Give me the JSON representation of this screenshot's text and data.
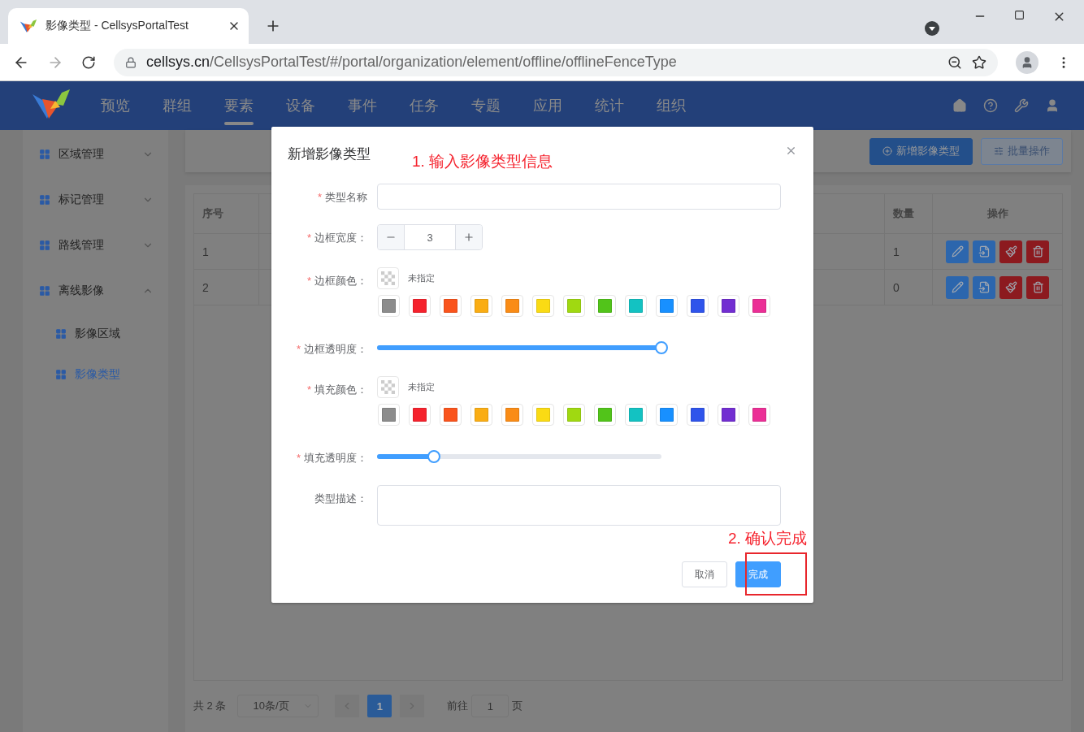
{
  "browser": {
    "tab_title": "影像类型 - CellsysPortalTest",
    "url": {
      "host": "cellsys.cn",
      "path": "/CellsysPortalTest/#/portal/organization/element/offline/offlineFenceType"
    }
  },
  "nav": {
    "items": [
      {
        "label": "预览",
        "selected": false
      },
      {
        "label": "群组",
        "selected": false
      },
      {
        "label": "要素",
        "selected": true
      },
      {
        "label": "设备",
        "selected": false
      },
      {
        "label": "事件",
        "selected": false
      },
      {
        "label": "任务",
        "selected": false
      },
      {
        "label": "专题",
        "selected": false
      },
      {
        "label": "应用",
        "selected": false
      },
      {
        "label": "统计",
        "selected": false
      },
      {
        "label": "组织",
        "selected": false
      }
    ]
  },
  "sidebar": {
    "items": [
      {
        "label": "区域管理",
        "expanded": false,
        "selected": false
      },
      {
        "label": "标记管理",
        "expanded": false,
        "selected": false
      },
      {
        "label": "路线管理",
        "expanded": false,
        "selected": false
      },
      {
        "label": "离线影像",
        "expanded": true,
        "selected": false,
        "children": [
          {
            "label": "影像区域",
            "selected": false
          },
          {
            "label": "影像类型",
            "selected": true
          }
        ]
      }
    ]
  },
  "toolbar": {
    "buttons": [
      {
        "label": "新增影像类型",
        "kind": "primary"
      },
      {
        "label": "批量操作",
        "kind": "plain"
      }
    ]
  },
  "table": {
    "columns": [
      "序号",
      "数量",
      "操作"
    ],
    "rows": [
      {
        "index": "1",
        "count": "1"
      },
      {
        "index": "2",
        "count": "0"
      }
    ]
  },
  "pagination": {
    "total": "共 2 条",
    "page_size": "10条/页",
    "pages": [
      {
        "label": "1",
        "selected": true
      }
    ],
    "goto_label": "前往",
    "goto_value": "1",
    "goto_suffix": "页"
  },
  "dialog": {
    "title": "新增影像类型",
    "fields": [
      {
        "kind": "text",
        "label": "类型名称",
        "marker": "*"
      },
      {
        "kind": "number",
        "label": "边框宽度：",
        "marker": "*",
        "value": "3"
      },
      {
        "kind": "color",
        "label": "边框颜色：",
        "marker": "*",
        "current": "未指定",
        "swatches": [
          {
            "color": "#8c8c8c"
          },
          {
            "color": "#f5222d"
          },
          {
            "color": "#fa541c"
          },
          {
            "color": "#faad14"
          },
          {
            "color": "#fa8c16"
          },
          {
            "color": "#fadb14"
          },
          {
            "color": "#a0d911"
          },
          {
            "color": "#52c41a"
          },
          {
            "color": "#13c2c2"
          },
          {
            "color": "#1890ff"
          },
          {
            "color": "#2f54eb"
          },
          {
            "color": "#722ed1"
          },
          {
            "color": "#eb2f96"
          }
        ]
      },
      {
        "kind": "slider",
        "label": "边框透明度：",
        "marker": "*",
        "level": 1
      },
      {
        "kind": "color",
        "label": "填充颜色：",
        "marker": "*",
        "current": "未指定",
        "swatches": [
          {
            "color": "#8c8c8c"
          },
          {
            "color": "#f5222d"
          },
          {
            "color": "#fa541c"
          },
          {
            "color": "#faad14"
          },
          {
            "color": "#fa8c16"
          },
          {
            "color": "#fadb14"
          },
          {
            "color": "#a0d911"
          },
          {
            "color": "#52c41a"
          },
          {
            "color": "#13c2c2"
          },
          {
            "color": "#1890ff"
          },
          {
            "color": "#2f54eb"
          },
          {
            "color": "#722ed1"
          },
          {
            "color": "#eb2f96"
          }
        ]
      },
      {
        "kind": "slider",
        "label": "填充透明度：",
        "marker": "*",
        "level": 0.2
      },
      {
        "kind": "textarea",
        "label": "类型描述："
      }
    ],
    "buttons": [
      {
        "label": "取消",
        "kind": "plain"
      },
      {
        "label": "完成",
        "kind": "primary"
      }
    ]
  },
  "annotations": [
    {
      "text": "1. 输入影像类型信息"
    },
    {
      "text": "2. 确认完成"
    }
  ]
}
